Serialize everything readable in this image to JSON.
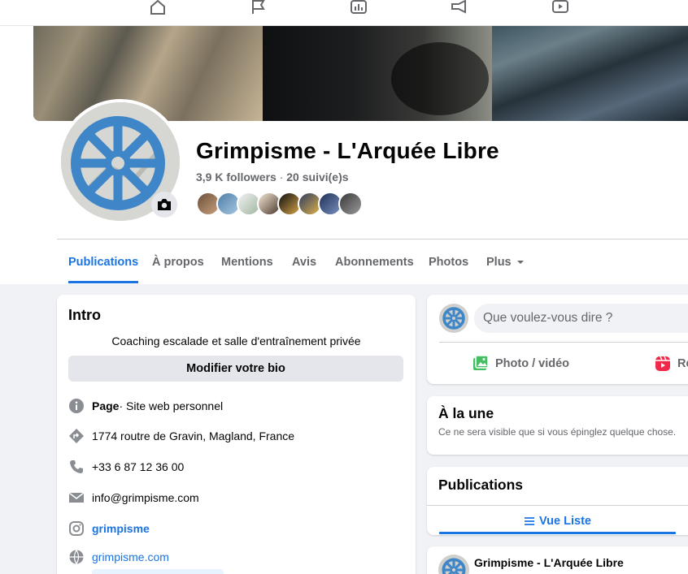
{
  "nav": {
    "icons": [
      "home-icon",
      "flag-icon",
      "chart-icon",
      "megaphone-icon",
      "play-icon"
    ]
  },
  "profile": {
    "title": "Grimpisme - L'Arquée Libre",
    "followers": "3,9 K followers",
    "separator": " · ",
    "following": "20 suivi(e)s"
  },
  "tabs": [
    {
      "label": "Publications"
    },
    {
      "label": "À propos"
    },
    {
      "label": "Mentions"
    },
    {
      "label": "Avis"
    },
    {
      "label": "Abonnements"
    },
    {
      "label": "Photos"
    },
    {
      "label": "Plus"
    }
  ],
  "intro": {
    "title": "Intro",
    "bio": "Coaching escalade et salle d'entraînement privée",
    "edit_bio_label": "Modifier votre bio",
    "page_label": "Page",
    "page_type": " · Site web personnel",
    "address": "1774 routre de Gravin, Magland, France",
    "phone": "+33 6 87 12 36 00",
    "email": "info@grimpisme.com",
    "instagram": "grimpisme",
    "website": "grimpisme.com"
  },
  "composer": {
    "placeholder": "Que voulez-vous dire ?",
    "photo_video_label": "Photo / vidéo",
    "reel_label": "Reel"
  },
  "featured": {
    "title": "À la une",
    "subtitle": "Ce ne sera visible que si vous épinglez quelque chose."
  },
  "posts": {
    "title": "Publications",
    "list_view_label": "Vue Liste",
    "first_author": "Grimpisme - L'Arquée Libre"
  },
  "colors": {
    "accent": "#1b74e4",
    "logo_blue": "#3f86c8",
    "background": "#f0f2f5"
  }
}
